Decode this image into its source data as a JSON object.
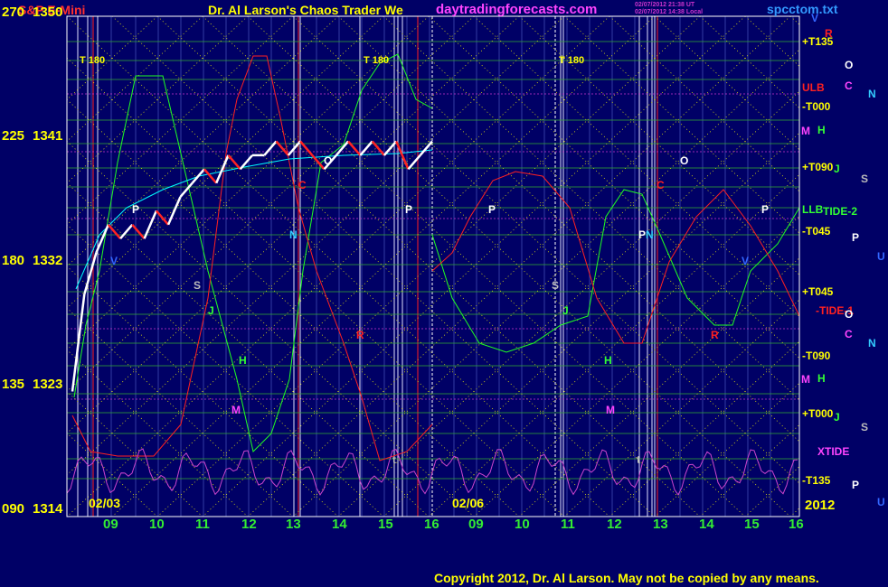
{
  "header": {
    "instrument": "S&P E-Mini",
    "title": "Dr. Al Larson's Chaos Trader We",
    "site": "daytradingforecasts.com",
    "stamp_line1": "02/07/2012 21:38 UT",
    "stamp_line2": "02/07/2012 14:38 Local",
    "file": "spcctom.txt"
  },
  "footer": {
    "copyright": "Copyright 2012, Dr. Al Larson. May not be copied by any means."
  },
  "colors": {
    "background": "#000066",
    "plot_border": "#ffffff",
    "yellow": "#ffff00",
    "green_grid": "#33aa33",
    "price_up": "#ffffff",
    "price_down": "#ff2222",
    "ma": "#00ffff",
    "xtide": "#cc44cc",
    "red_line": "#ff2020",
    "green_line": "#20ff20"
  },
  "chart_data": {
    "type": "line",
    "title": "S&P E-Mini",
    "left_axis_angle_labels": [
      "270",
      "225",
      "180",
      "135",
      "090"
    ],
    "left_axis_price_labels": [
      "1350",
      "1341",
      "1332",
      "1323",
      "1314"
    ],
    "ylim": [
      1314,
      1350
    ],
    "x_tick_labels": [
      "09",
      "10",
      "11",
      "12",
      "13",
      "14",
      "15",
      "16",
      "09",
      "10",
      "11",
      "12",
      "13",
      "14",
      "15",
      "16"
    ],
    "date_labels": [
      "02/03",
      "02/06"
    ],
    "year_label": "2012",
    "right_level_labels": [
      "+T135",
      "ULB",
      "-T000",
      "+T090",
      "LLB",
      "-T045",
      "+T045",
      "-T090",
      "+T000",
      "XTIDE",
      "-T135"
    ],
    "right_symbol_labels": [
      "V",
      "R",
      "O",
      "C",
      "N",
      "M",
      "H",
      "J",
      "S",
      "TIDE-2",
      "P",
      "U",
      "-TIDE-1",
      "O",
      "C",
      "N",
      "M",
      "H",
      "J",
      "S",
      "P",
      "U"
    ],
    "marker_labels": [
      "T 180",
      "T 180",
      "T 180"
    ],
    "in_plot_letters": [
      "P",
      "P",
      "P",
      "P",
      "P",
      "N",
      "N",
      "O",
      "O",
      "C",
      "C",
      "S",
      "S",
      "R",
      "R",
      "H",
      "H",
      "M",
      "M",
      "V",
      "V",
      "J",
      "J",
      "t",
      "t"
    ],
    "series": [
      {
        "name": "S&P E-Mini",
        "points": [
          [
            0,
            1323
          ],
          [
            1,
            1330
          ],
          [
            2,
            1333
          ],
          [
            3,
            1335
          ],
          [
            4,
            1334
          ],
          [
            5,
            1335
          ],
          [
            6,
            1334
          ],
          [
            7,
            1336
          ],
          [
            8,
            1335
          ],
          [
            9,
            1337
          ],
          [
            10,
            1338
          ],
          [
            11,
            1339
          ],
          [
            12,
            1338
          ],
          [
            13,
            1340
          ],
          [
            14,
            1339
          ],
          [
            15,
            1340
          ],
          [
            16,
            1340
          ],
          [
            17,
            1341
          ],
          [
            18,
            1340
          ],
          [
            19,
            1341
          ],
          [
            20,
            1340
          ],
          [
            21,
            1339
          ],
          [
            22,
            1340
          ],
          [
            23,
            1341
          ],
          [
            24,
            1340
          ],
          [
            25,
            1341
          ],
          [
            26,
            1340
          ],
          [
            27,
            1341
          ],
          [
            28,
            1339
          ],
          [
            29,
            1340
          ],
          [
            30,
            1341
          ]
        ]
      }
    ]
  }
}
